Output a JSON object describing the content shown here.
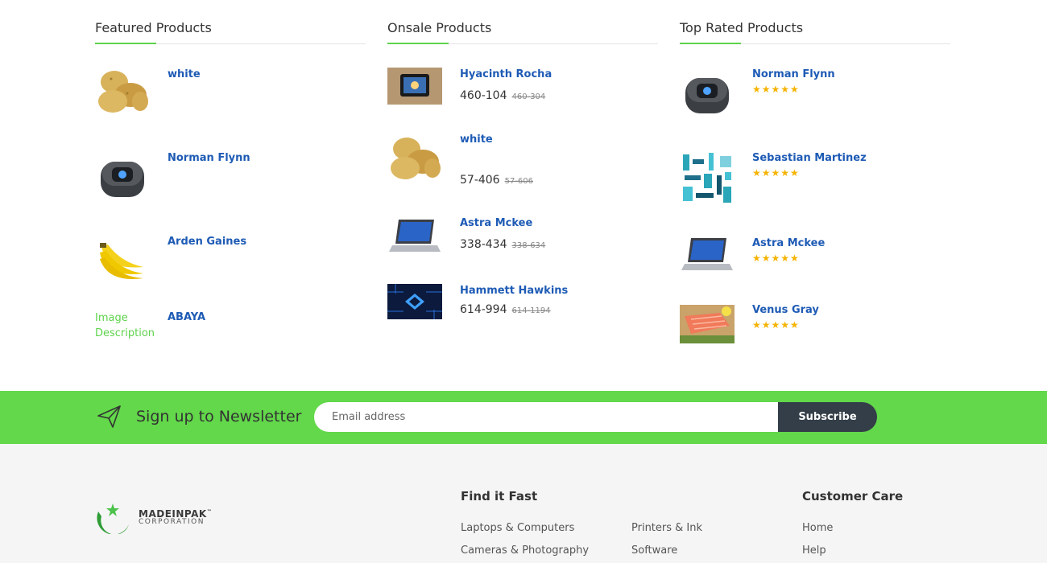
{
  "featured": {
    "title": "Featured Products",
    "items": [
      {
        "name": "white",
        "image": "potatoes"
      },
      {
        "name": "Norman Flynn",
        "image": "speaker"
      },
      {
        "name": "Arden Gaines",
        "image": "bananas"
      },
      {
        "name": "ABAYA",
        "image_alt": "Image Description"
      }
    ]
  },
  "onsale": {
    "title": "Onsale Products",
    "items": [
      {
        "name": "Hyacinth Rocha",
        "price": "460-104",
        "old_price": "460-304",
        "image": "tablet-dock"
      },
      {
        "name": "white",
        "price": "57-406",
        "old_price": "57-606",
        "image": "potatoes"
      },
      {
        "name": "Astra Mckee",
        "price": "338-434",
        "old_price": "338-634",
        "image": "laptop"
      },
      {
        "name": "Hammett Hawkins",
        "price": "614-994",
        "old_price": "614-1194",
        "image": "circuit-chip"
      }
    ]
  },
  "toprated": {
    "title": "Top Rated Products",
    "rating": 5,
    "items": [
      {
        "name": "Norman Flynn",
        "image": "speaker"
      },
      {
        "name": "Sebastian Martinez",
        "image": "tools-pattern"
      },
      {
        "name": "Astra Mckee",
        "image": "laptop"
      },
      {
        "name": "Venus Gray",
        "image": "salmon"
      }
    ]
  },
  "newsletter": {
    "title": "Sign up to Newsletter",
    "placeholder": "Email address",
    "button": "Subscribe",
    "background": "#62d84a"
  },
  "footer": {
    "logo_name": "MADEINPAK",
    "logo_tm": "™",
    "logo_sub": "CORPORATION",
    "find_it_fast": {
      "title": "Find it Fast",
      "links_col1": [
        "Laptops & Computers",
        "Cameras & Photography"
      ],
      "links_col2": [
        "Printers & Ink",
        "Software"
      ]
    },
    "customer_care": {
      "title": "Customer Care",
      "links": [
        "Home",
        "Help"
      ]
    }
  },
  "colors": {
    "accent": "#5ed34c",
    "link": "#1e5bb5",
    "star": "#f5b301",
    "button_dark": "#333e48"
  }
}
